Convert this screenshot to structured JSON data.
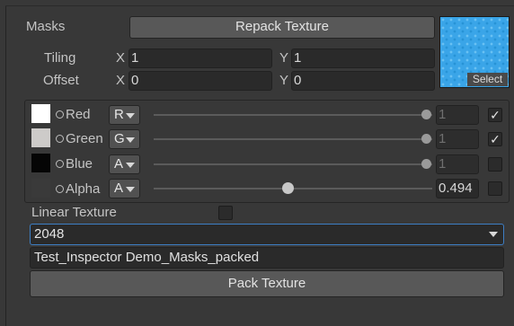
{
  "header": {
    "label": "Masks",
    "repack_button": "Repack Texture",
    "texture_select": "Select"
  },
  "tiling": {
    "label": "Tiling",
    "x_label": "X",
    "x_value": "1",
    "y_label": "Y",
    "y_value": "1"
  },
  "offset": {
    "label": "Offset",
    "x_label": "X",
    "x_value": "0",
    "y_label": "Y",
    "y_value": "0"
  },
  "channels": [
    {
      "label": "Red",
      "source": "R",
      "value": "1",
      "slider_fraction": 1.0,
      "enabled": true,
      "swatch_color": "#ffffff"
    },
    {
      "label": "Green",
      "source": "G",
      "value": "1",
      "slider_fraction": 1.0,
      "enabled": true,
      "swatch_color": "#cdcbc9"
    },
    {
      "label": "Blue",
      "source": "A",
      "value": "1",
      "slider_fraction": 1.0,
      "enabled": false,
      "swatch_color": "#050505"
    },
    {
      "label": "Alpha",
      "source": "A",
      "value": "0.494",
      "slider_fraction": 0.494,
      "enabled": false,
      "swatch_color": "#3a3a3a"
    }
  ],
  "linear": {
    "label": "Linear Texture",
    "checked": false
  },
  "resolution": {
    "selected": "2048"
  },
  "output": {
    "name": "Test_Inspector Demo_Masks_packed"
  },
  "pack_button": "Pack Texture",
  "colors": {
    "accent": "#3d7ec4",
    "texture": "#3aa5e8",
    "background": "#383838"
  }
}
